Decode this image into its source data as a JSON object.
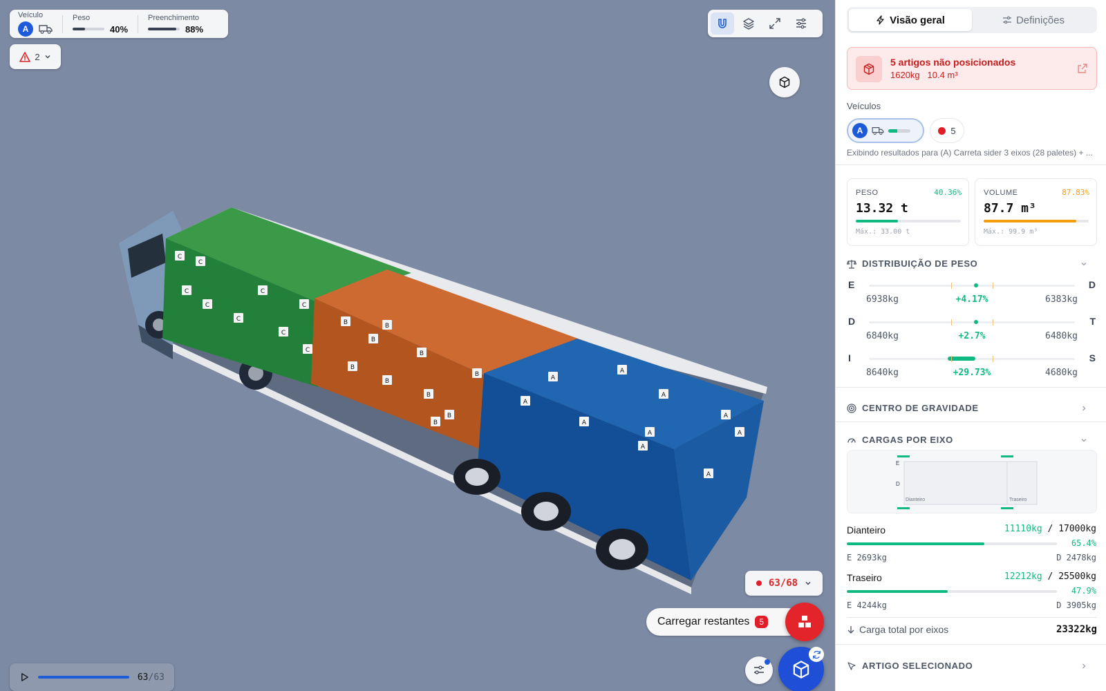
{
  "topbar": {
    "vehicle_label": "Veículo",
    "vehicle_badge": "A",
    "weight_label": "Peso",
    "weight_value": "40%",
    "weight_fraction": 0.4,
    "fill_label": "Preenchimento",
    "fill_value": "88%",
    "fill_fraction": 0.88
  },
  "warnings": {
    "count": "2"
  },
  "toolbar": {
    "icons": [
      "magnet-icon",
      "layers-icon",
      "expand-icon",
      "sliders-icon"
    ],
    "active": "magnet-icon"
  },
  "scene": {
    "box_labels": [
      "A",
      "B",
      "C"
    ],
    "colors": {
      "green": "#2f8a3e",
      "orange": "#c4622c",
      "blue": "#1f5fa8",
      "cab": "#6e87a8"
    }
  },
  "items_counter": "63/68",
  "load_remaining": {
    "label": "Carregar restantes",
    "count": "5"
  },
  "player": {
    "current": "63",
    "total": "/63",
    "progress": 1.0
  },
  "sidebar": {
    "tabs": [
      {
        "label": "Visão geral",
        "active": true
      },
      {
        "label": "Definições",
        "active": false
      }
    ],
    "alert": {
      "title": "5 artigos não posicionados",
      "weight": "1620kg",
      "volume": "10.4 m³"
    },
    "vehicles_label": "Veículos",
    "vehicle_chip": {
      "badge": "A",
      "fill": 0.4
    },
    "unplaced_count": "5",
    "showing_text": "Exibindo resultados para (A) Carreta sider 3 eixos (28 paletes) + ...",
    "weight_card": {
      "label": "PESO",
      "pct": "40.36%",
      "value": "13.32 t",
      "max": "Máx.: 33.00 t",
      "fraction": 0.4036,
      "color": "#10b981"
    },
    "volume_card": {
      "label": "VOLUME",
      "pct": "87.83%",
      "value": "87.7 m³",
      "max": "Máx.: 99.9 m³",
      "fraction": 0.8783,
      "color": "#f59e0b"
    },
    "weight_dist": {
      "title": "DISTRIBUIÇÃO DE PESO",
      "rows": [
        {
          "left": "E",
          "right": "D",
          "left_val": "6938kg",
          "mid": "+4.17%",
          "right_val": "6383kg",
          "pos": 0.52
        },
        {
          "left": "D",
          "right": "T",
          "left_val": "6840kg",
          "mid": "+2.7%",
          "right_val": "6480kg",
          "pos": 0.52
        },
        {
          "left": "I",
          "right": "S",
          "left_val": "8640kg",
          "mid": "+29.73%",
          "right_val": "4680kg",
          "pos": 0.45
        }
      ]
    },
    "cog": {
      "title": "CENTRO DE GRAVIDADE"
    },
    "axle_loads": {
      "title": "CARGAS POR EIXO",
      "figure": {
        "e": "E",
        "d": "D",
        "front": "Dianteiro",
        "rear": "Traseiro"
      },
      "axles": [
        {
          "name": "Dianteiro",
          "load": "11110kg",
          "limit": "/ 17000kg",
          "pct": "65.4%",
          "fraction": 0.654,
          "e": "E 2693kg",
          "d": "D 2478kg"
        },
        {
          "name": "Traseiro",
          "load": "12212kg",
          "limit": "/ 25500kg",
          "pct": "47.9%",
          "fraction": 0.479,
          "e": "E 4244kg",
          "d": "D 3905kg"
        }
      ],
      "total_label": "Carga total por eixos",
      "total_value": "23322kg"
    },
    "selected_item": {
      "title": "ARTIGO SELECIONADO"
    }
  }
}
